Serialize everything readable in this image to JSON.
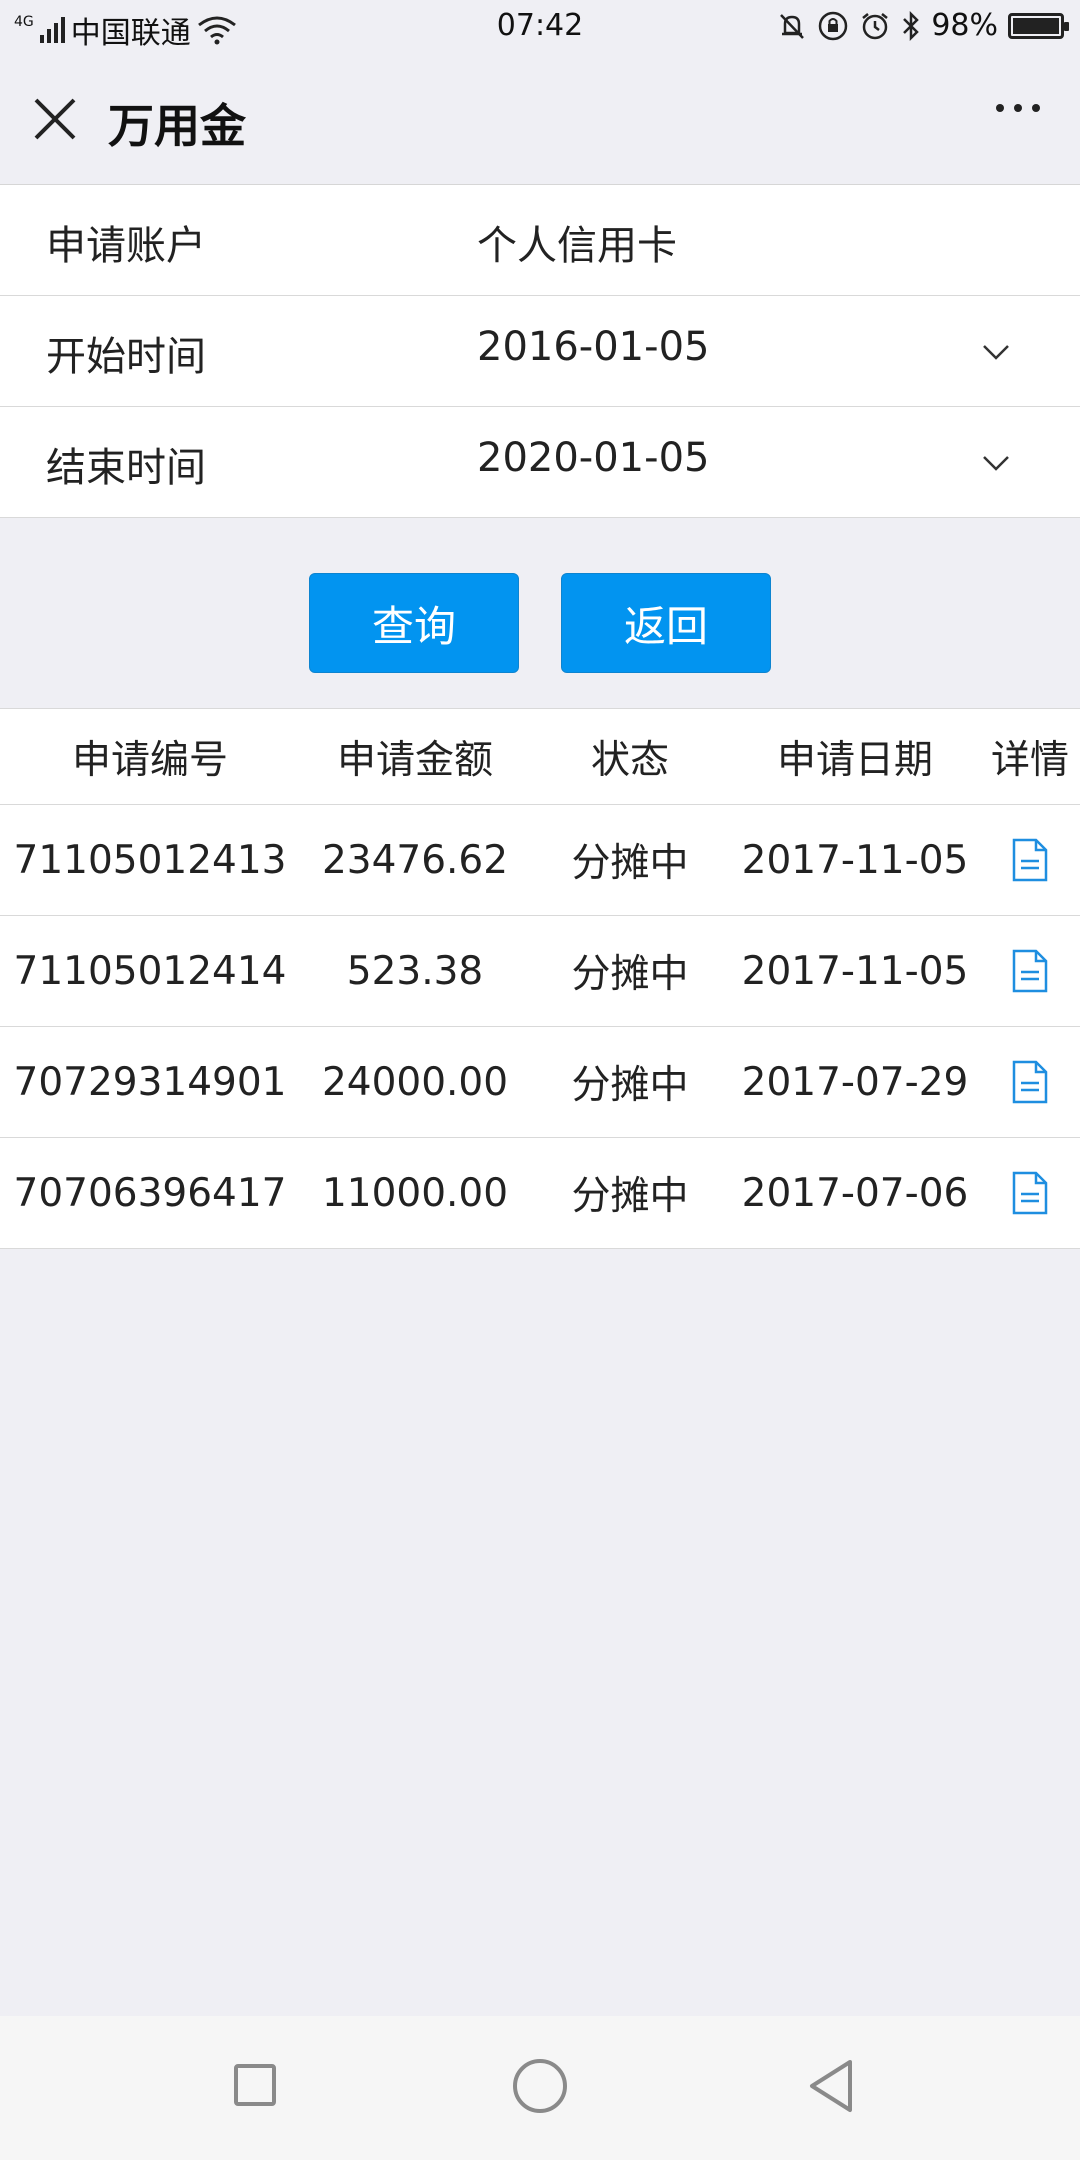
{
  "status_bar": {
    "network": "4G",
    "carrier": "中国联通",
    "time": "07:42",
    "battery": "98%"
  },
  "header": {
    "title": "万用金"
  },
  "form": [
    {
      "label": "申请账户",
      "value": "个人信用卡",
      "has_dropdown": false
    },
    {
      "label": "开始时间",
      "value": "2016-01-05",
      "has_dropdown": true
    },
    {
      "label": "结束时间",
      "value": "2020-01-05",
      "has_dropdown": true
    }
  ],
  "buttons": {
    "query": "查询",
    "back": "返回"
  },
  "table": {
    "columns": [
      "申请编号",
      "申请金额",
      "状态",
      "申请日期",
      "详情"
    ],
    "rows": [
      {
        "id": "71105012413",
        "amount": "23476.62",
        "status": "分摊中",
        "date": "2017-11-05"
      },
      {
        "id": "71105012414",
        "amount": "523.38",
        "status": "分摊中",
        "date": "2017-11-05"
      },
      {
        "id": "70729314901",
        "amount": "24000.00",
        "status": "分摊中",
        "date": "2017-07-29"
      },
      {
        "id": "70706396417",
        "amount": "11000.00",
        "status": "分摊中",
        "date": "2017-07-06"
      }
    ]
  },
  "colors": {
    "accent": "#0294f0",
    "background": "#efeff4",
    "doc_icon": "#1e8ee0"
  }
}
